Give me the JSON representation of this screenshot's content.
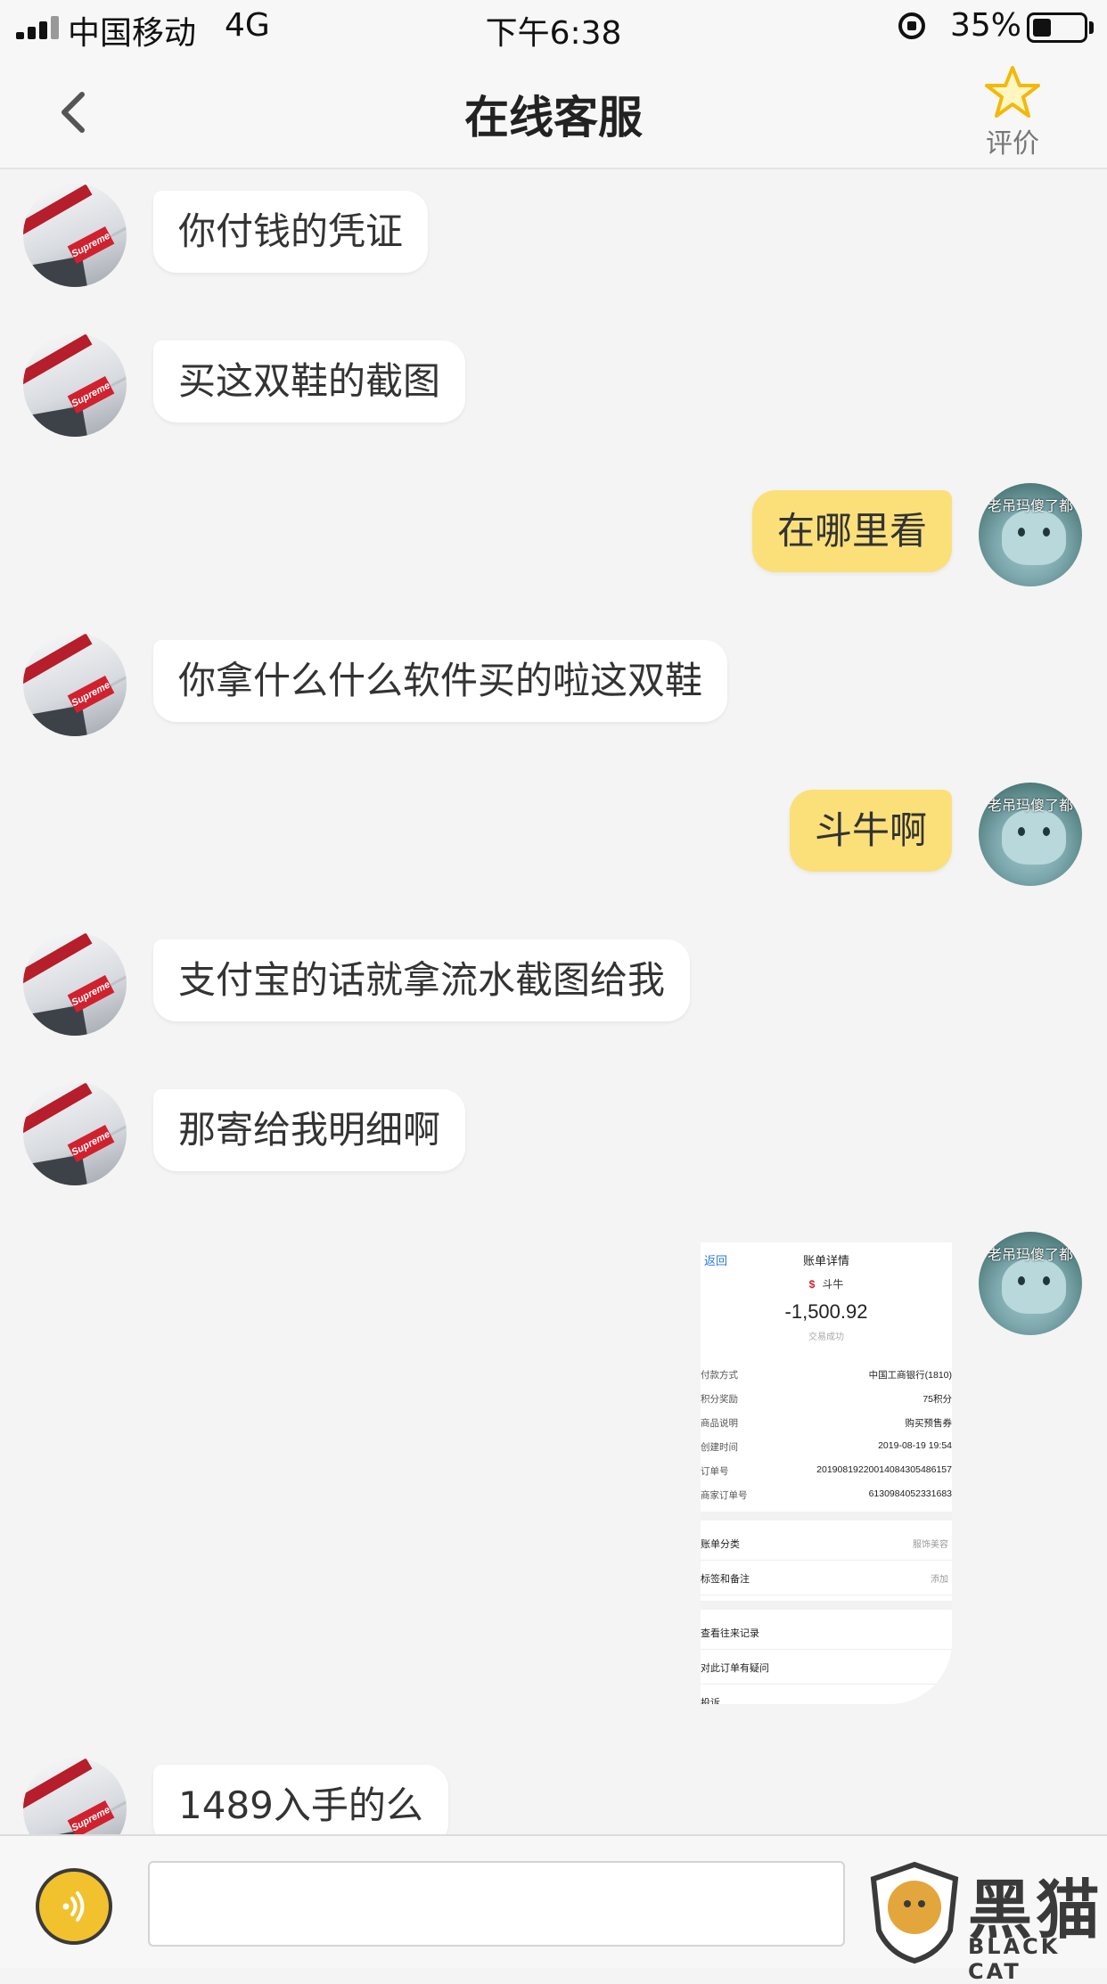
{
  "status_bar": {
    "carrier": "中国移动",
    "network": "4G",
    "time": "下午6:38",
    "battery": "35%",
    "battery_level": 0.35
  },
  "nav": {
    "title": "在线客服",
    "back_icon": "chevron-left-icon",
    "rate_icon": "star-icon",
    "rate_label": "评价",
    "accent": "#f5c518"
  },
  "colors": {
    "own_bubble": "#fbe07a",
    "other_bubble": "#ffffff",
    "background": "#f4f4f4"
  },
  "avatars": {
    "other_logo": "Supreme",
    "self_caption": "老吊玛傻了都"
  },
  "messages": [
    {
      "side": "left",
      "text": "你付钱的凭证"
    },
    {
      "side": "left",
      "text": "买这双鞋的截图"
    },
    {
      "side": "right",
      "text": "在哪里看"
    },
    {
      "side": "left",
      "text": "你拿什么什么软件买的啦这双鞋"
    },
    {
      "side": "right",
      "text": "斗牛啊"
    },
    {
      "side": "left",
      "text": "支付宝的话就拿流水截图给我"
    },
    {
      "side": "left",
      "text": "那寄给我明细啊"
    },
    {
      "side": "left",
      "text": "1489入手的么"
    }
  ],
  "receipt": {
    "back": "返回",
    "title": "账单详情",
    "merchant": "斗牛",
    "amount": "-1,500.92",
    "state": "交易成功",
    "details": [
      {
        "label": "付款方式",
        "value": "中国工商银行(1810)"
      },
      {
        "label": "积分奖励",
        "value": "75积分"
      },
      {
        "label": "商品说明",
        "value": "购买预售券"
      },
      {
        "label": "创建时间",
        "value": "2019-08-19 19:54"
      },
      {
        "label": "订单号",
        "value": "20190819220014084305486157"
      },
      {
        "label": "商家订单号",
        "value": "6130984052331683"
      }
    ],
    "category_label": "账单分类",
    "category_value": "服饰美容",
    "tags_label": "标签和备注",
    "tags_value": "添加",
    "history_label": "查看往来记录",
    "question_label": "对此订单有疑问",
    "complain_label": "投诉"
  },
  "input": {
    "voice_icon": "voice-icon",
    "placeholder": ""
  },
  "watermark": {
    "text": "黑猫",
    "sub": "BLACK CAT",
    "icon": "cat-shield-icon"
  }
}
